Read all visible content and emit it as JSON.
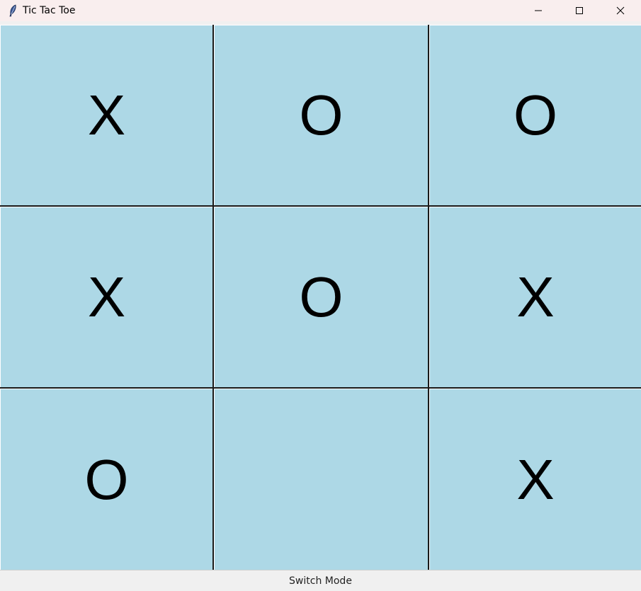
{
  "window": {
    "title": "Tic Tac Toe",
    "icon": "feather-icon",
    "controls": [
      "minimize-icon",
      "maximize-icon",
      "close-icon"
    ]
  },
  "board": {
    "cell_color": "#add8e6",
    "grid_color": "#1a1a1a",
    "cells": [
      [
        "X",
        "O",
        "O"
      ],
      [
        "X",
        "O",
        "X"
      ],
      [
        "O",
        "",
        "X"
      ]
    ]
  },
  "footer": {
    "button_label": "Switch Mode"
  }
}
